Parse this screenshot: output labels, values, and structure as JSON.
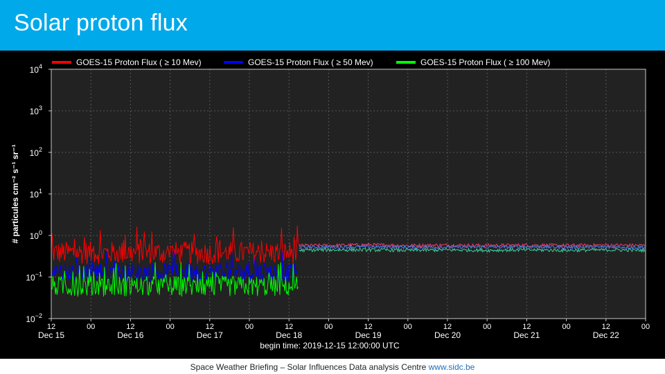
{
  "slide": {
    "title": "Solar proton flux",
    "footer_text": "Space Weather Briefing – Solar Influences Data analysis Centre ",
    "footer_link": "www.sidc.be"
  },
  "colors": {
    "header_bg": "#00a9ea",
    "plot_bg": "#222222",
    "panel_bg": "#000000",
    "series_10mev": "#ff0000",
    "series_50mev": "#0000ff",
    "series_100mev": "#00ff00",
    "series_after_10mev": "#e8406a",
    "series_after_50mev": "#4a7fff",
    "series_after_100mev": "#3fcf9a"
  },
  "chart_data": {
    "type": "line",
    "title": "",
    "xlabel": "begin time: 2019-12-15 12:00:00 UTC",
    "ylabel": "# particules cm⁻² s⁻¹ sr⁻¹",
    "yscale": "log",
    "ylim": [
      0.01,
      10000
    ],
    "y_ticks": [
      {
        "value": 10000,
        "base": "10",
        "exp": "4"
      },
      {
        "value": 1000,
        "base": "10",
        "exp": "3"
      },
      {
        "value": 100,
        "base": "10",
        "exp": "2"
      },
      {
        "value": 10,
        "base": "10",
        "exp": "1"
      },
      {
        "value": 1,
        "base": "10",
        "exp": "0"
      },
      {
        "value": 0.1,
        "base": "10",
        "exp": "−1"
      },
      {
        "value": 0.01,
        "base": "10",
        "exp": "−2"
      }
    ],
    "xlim": [
      "2019-12-15 12:00",
      "2019-12-23 00:00"
    ],
    "x_ticks": [
      {
        "time": "2019-12-15 12:00",
        "hour": "12",
        "day": "Dec 15"
      },
      {
        "time": "2019-12-16 00:00",
        "hour": "00",
        "day": ""
      },
      {
        "time": "2019-12-16 12:00",
        "hour": "12",
        "day": "Dec 16"
      },
      {
        "time": "2019-12-17 00:00",
        "hour": "00",
        "day": ""
      },
      {
        "time": "2019-12-17 12:00",
        "hour": "12",
        "day": "Dec 17"
      },
      {
        "time": "2019-12-18 00:00",
        "hour": "00",
        "day": ""
      },
      {
        "time": "2019-12-18 12:00",
        "hour": "12",
        "day": "Dec 18"
      },
      {
        "time": "2019-12-19 00:00",
        "hour": "00",
        "day": ""
      },
      {
        "time": "2019-12-19 12:00",
        "hour": "12",
        "day": "Dec 19"
      },
      {
        "time": "2019-12-20 00:00",
        "hour": "00",
        "day": ""
      },
      {
        "time": "2019-12-20 12:00",
        "hour": "12",
        "day": "Dec 20"
      },
      {
        "time": "2019-12-21 00:00",
        "hour": "00",
        "day": ""
      },
      {
        "time": "2019-12-21 12:00",
        "hour": "12",
        "day": "Dec 21"
      },
      {
        "time": "2019-12-22 00:00",
        "hour": "00",
        "day": ""
      },
      {
        "time": "2019-12-22 12:00",
        "hour": "12",
        "day": "Dec 22"
      },
      {
        "time": "2019-12-23 00:00",
        "hour": "00",
        "day": ""
      }
    ],
    "grid": true,
    "legend_position": "top",
    "series": [
      {
        "name": "GOES-15 Proton Flux ( ≥ 10 Mev)",
        "color": "#ff0000",
        "x": [
          "2019-12-15 12:00",
          "2019-12-16 00:00",
          "2019-12-16 12:00",
          "2019-12-17 00:00",
          "2019-12-17 12:00",
          "2019-12-18 00:00",
          "2019-12-18 12:00",
          "2019-12-18 15:00",
          "2019-12-19 00:00",
          "2019-12-19 12:00",
          "2019-12-20 00:00",
          "2019-12-20 12:00",
          "2019-12-21 00:00",
          "2019-12-21 12:00",
          "2019-12-22 00:00",
          "2019-12-22 12:00",
          "2019-12-23 00:00"
        ],
        "y": [
          0.28,
          0.3,
          0.28,
          0.29,
          0.3,
          0.28,
          0.29,
          0.55,
          0.55,
          0.57,
          0.55,
          0.56,
          0.55,
          0.56,
          0.55,
          0.56,
          0.55
        ]
      },
      {
        "name": "GOES-15 Proton Flux ( ≥ 50 Mev)",
        "color": "#0000ff",
        "x": [
          "2019-12-15 12:00",
          "2019-12-16 00:00",
          "2019-12-16 12:00",
          "2019-12-17 00:00",
          "2019-12-17 12:00",
          "2019-12-18 00:00",
          "2019-12-18 12:00",
          "2019-12-18 15:00",
          "2019-12-19 00:00",
          "2019-12-19 12:00",
          "2019-12-20 00:00",
          "2019-12-20 12:00",
          "2019-12-21 00:00",
          "2019-12-21 12:00",
          "2019-12-22 00:00",
          "2019-12-22 12:00",
          "2019-12-23 00:00"
        ],
        "y": [
          0.1,
          0.11,
          0.1,
          0.1,
          0.11,
          0.1,
          0.1,
          0.5,
          0.5,
          0.51,
          0.5,
          0.5,
          0.5,
          0.51,
          0.5,
          0.5,
          0.5
        ]
      },
      {
        "name": "GOES-15 Proton Flux ( ≥ 100 Mev)",
        "color": "#00ff00",
        "x": [
          "2019-12-15 12:00",
          "2019-12-16 00:00",
          "2019-12-16 12:00",
          "2019-12-17 00:00",
          "2019-12-17 12:00",
          "2019-12-18 00:00",
          "2019-12-18 12:00",
          "2019-12-18 15:00",
          "2019-12-19 00:00",
          "2019-12-19 12:00",
          "2019-12-20 00:00",
          "2019-12-20 12:00",
          "2019-12-21 00:00",
          "2019-12-21 12:00",
          "2019-12-22 00:00",
          "2019-12-22 12:00",
          "2019-12-23 00:00"
        ],
        "y": [
          0.045,
          0.048,
          0.045,
          0.046,
          0.048,
          0.045,
          0.046,
          0.42,
          0.43,
          0.43,
          0.42,
          0.43,
          0.42,
          0.43,
          0.42,
          0.43,
          0.42
        ]
      }
    ]
  }
}
